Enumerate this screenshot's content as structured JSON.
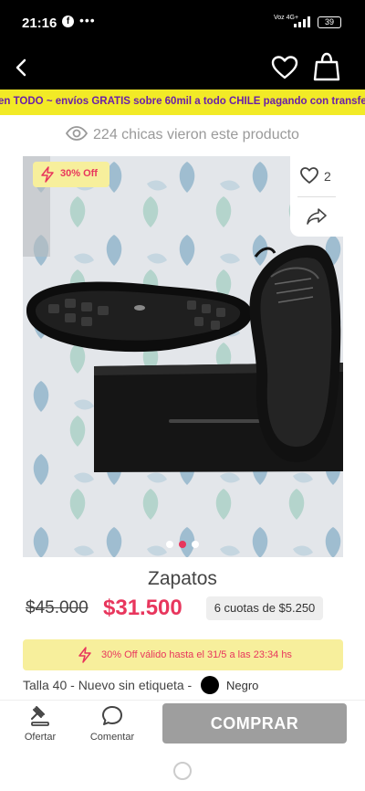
{
  "status_bar": {
    "time": "21:16",
    "notification_dots": "•••",
    "network": "Voz 4G+",
    "battery": "39"
  },
  "promo_banner": {
    "text": "en TODO ~ envíos GRATIS sobre 60mil a todo CHILE pagando con transferencia"
  },
  "viewers": {
    "text": "224 chicas vieron este producto"
  },
  "product": {
    "discount_badge": "30% Off",
    "likes": "2",
    "image_count": 3,
    "active_image": 2,
    "title": "Zapatos",
    "old_price": "$45.000",
    "new_price": "$31.500",
    "installments": "6 cuotas de $5.250",
    "offer_banner": "30% Off válido hasta el 31/5 a las 23:34 hs",
    "details": "Talla 40 - Nuevo sin etiqueta -",
    "color_name": "Negro",
    "color_hex": "#000000"
  },
  "actions": {
    "ofertar": "Ofertar",
    "comentar": "Comentar",
    "buy": "COMPRAR"
  },
  "colors": {
    "accent_pink": "#e8365d",
    "promo_yellow": "#f2ea26",
    "promo_text": "#6a1fa8",
    "buy_button": "#9e9e9e"
  }
}
